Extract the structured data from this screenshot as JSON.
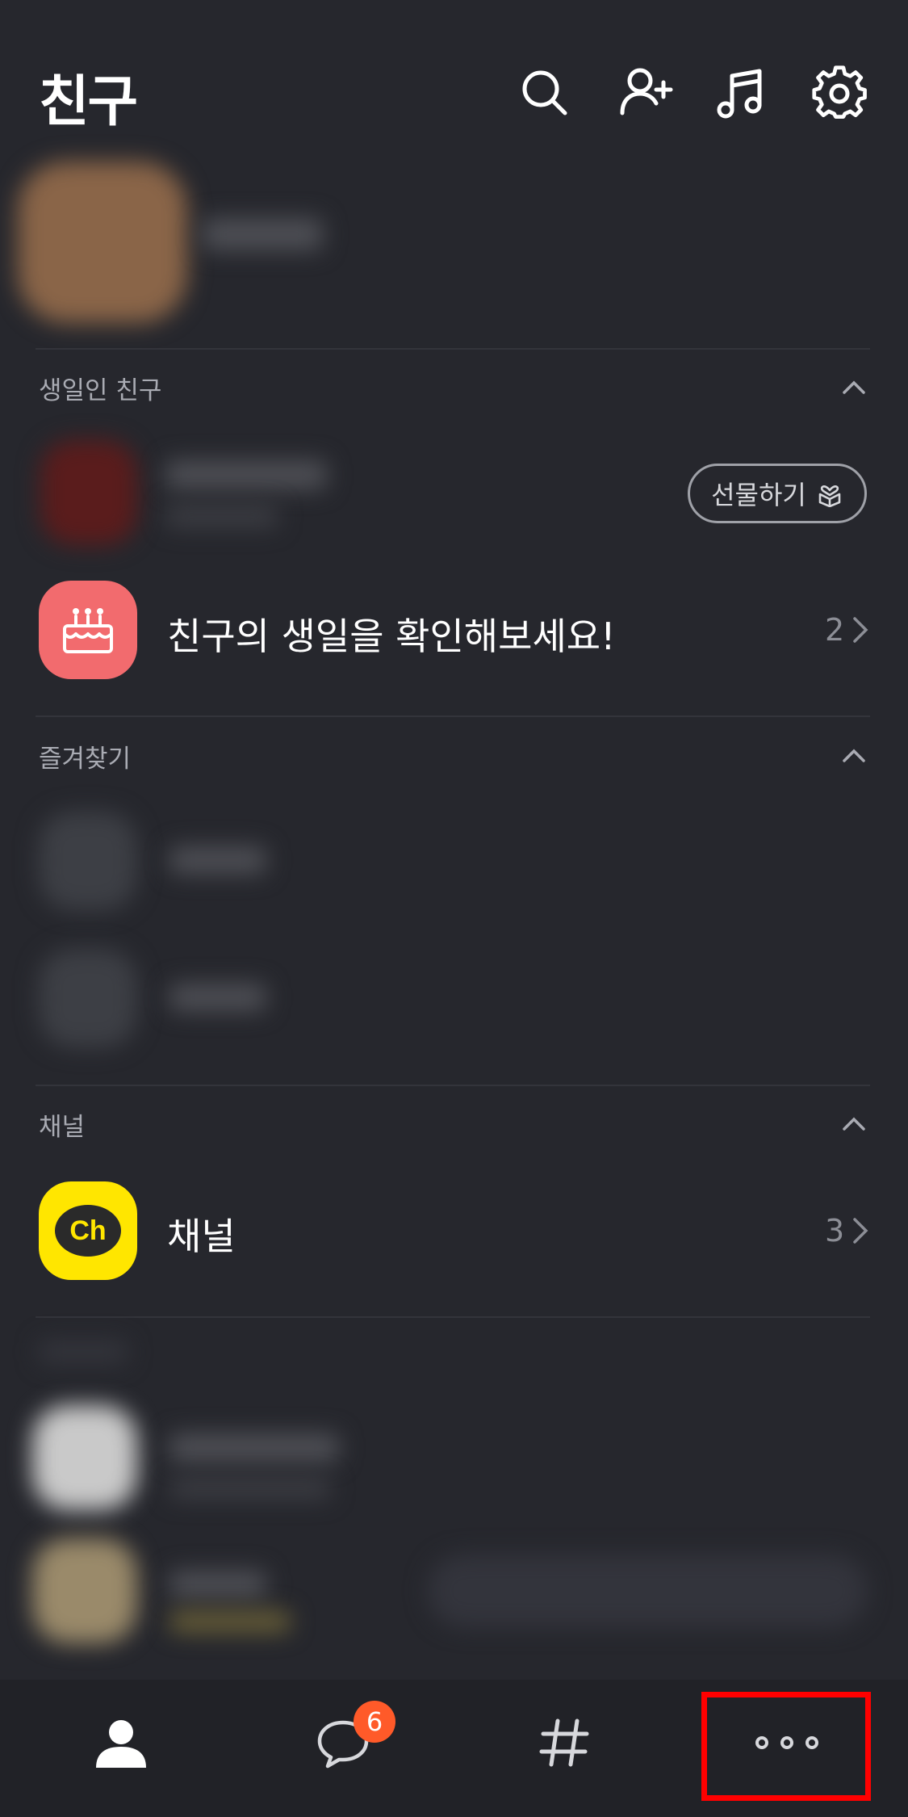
{
  "header": {
    "title": "친구",
    "icons": [
      "search-icon",
      "add-friend-icon",
      "music-icon",
      "settings-icon"
    ]
  },
  "sections": {
    "birthday": {
      "label": "생일인 친구",
      "gift_button": "선물하기",
      "banner_text": "친구의 생일을 확인해보세요!",
      "banner_count": "2"
    },
    "favorites": {
      "label": "즐겨찾기"
    },
    "channel": {
      "label": "채널",
      "logo_text": "Ch",
      "title": "채널",
      "count": "3"
    }
  },
  "tabbar": {
    "tabs": [
      "friends-tab",
      "chats-tab",
      "open-chat-tab",
      "more-tab"
    ],
    "chat_badge": "6"
  },
  "colors": {
    "background": "#26272d",
    "tabbar": "#212227",
    "birthday_icon_bg": "#f26b6e",
    "channel_logo_bg": "#ffe600",
    "badge": "#ff5a29",
    "highlight_box": "#ff0000"
  }
}
